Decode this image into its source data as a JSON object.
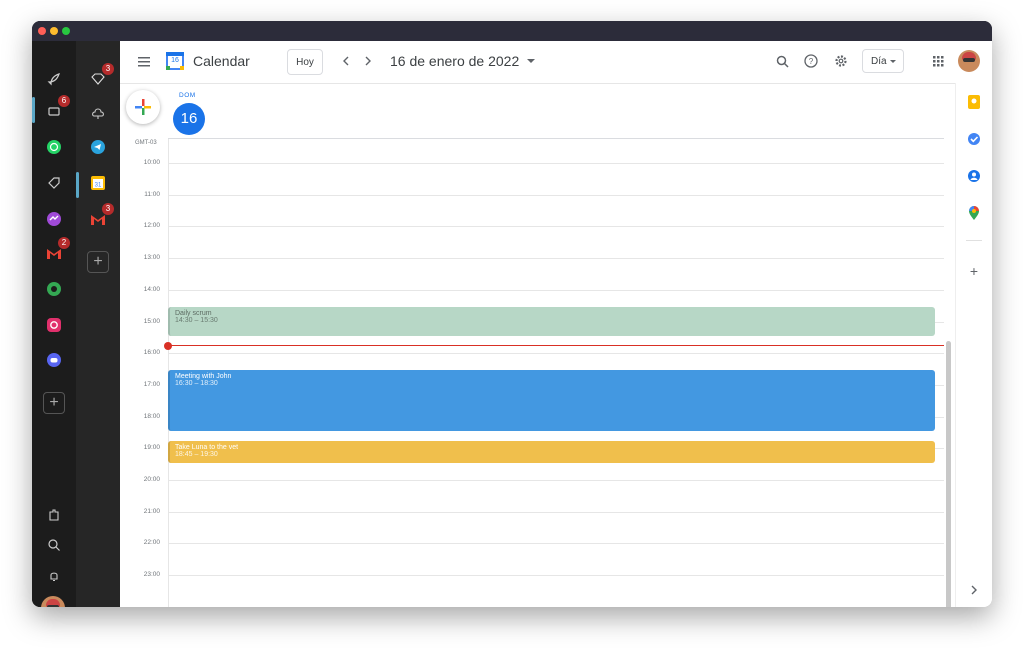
{
  "window": {
    "traffic_lights": [
      "#ff5f57",
      "#febc2e",
      "#28c840"
    ]
  },
  "rail1": {
    "items": [
      {
        "name": "rocket-icon",
        "glyph": "🚀",
        "badge": ""
      },
      {
        "name": "inbox-icon",
        "glyph": "▭",
        "badge": "6"
      },
      {
        "name": "whatsapp-icon",
        "glyph": "✆",
        "badge": ""
      },
      {
        "name": "tag-icon",
        "glyph": "◇",
        "badge": ""
      },
      {
        "name": "messenger-icon",
        "glyph": "ϟ",
        "badge": ""
      },
      {
        "name": "gmail-icon",
        "glyph": "M",
        "badge": "2"
      },
      {
        "name": "hangouts-icon",
        "glyph": "❝",
        "badge": ""
      },
      {
        "name": "instagram-icon",
        "glyph": "◎",
        "badge": ""
      },
      {
        "name": "discord-icon",
        "glyph": "◉",
        "badge": ""
      }
    ],
    "bottom": [
      {
        "name": "puzzle-icon",
        "glyph": "⧉"
      },
      {
        "name": "search-icon",
        "glyph": "⌕"
      },
      {
        "name": "bell-icon",
        "glyph": "♫"
      }
    ]
  },
  "rail2": {
    "items": [
      {
        "name": "gem-icon",
        "glyph": "◆",
        "badge": "3"
      },
      {
        "name": "cloud-icon",
        "glyph": "☁",
        "badge": ""
      },
      {
        "name": "telegram-icon",
        "glyph": "➤",
        "badge": ""
      },
      {
        "name": "calendar-app-icon",
        "glyph": "31",
        "badge": ""
      },
      {
        "name": "gmail-icon",
        "glyph": "M",
        "badge": "3"
      }
    ]
  },
  "header": {
    "app_title": "Calendar",
    "logo_day": "16",
    "today_button": "Hoy",
    "date_title": "16 de enero de 2022",
    "view_select": "Día"
  },
  "day": {
    "weekday": "DOM",
    "number": "16",
    "timezone": "GMT-03"
  },
  "hours": [
    "10:00",
    "11:00",
    "12:00",
    "13:00",
    "14:00",
    "15:00",
    "16:00",
    "17:00",
    "18:00",
    "19:00",
    "20:00",
    "21:00",
    "22:00",
    "23:00"
  ],
  "events": [
    {
      "title": "Daily scrum",
      "time": "14:30 – 15:30",
      "color": "#b7d7c6",
      "text_color": "#5c6b62"
    },
    {
      "title": "Meeting with John",
      "time": "16:30 – 18:30",
      "color": "#4398e1",
      "text_color": "#ffffff"
    },
    {
      "title": "Take Luna to the vet",
      "time": "18:45 – 19:30",
      "color": "#f0bf4c",
      "text_color": "#ffffff"
    }
  ],
  "now_line_color": "#d93025",
  "side_panel": {
    "icons": [
      "keep-icon",
      "tasks-icon",
      "contacts-icon",
      "maps-icon",
      "add-icon",
      "expand-icon"
    ]
  }
}
